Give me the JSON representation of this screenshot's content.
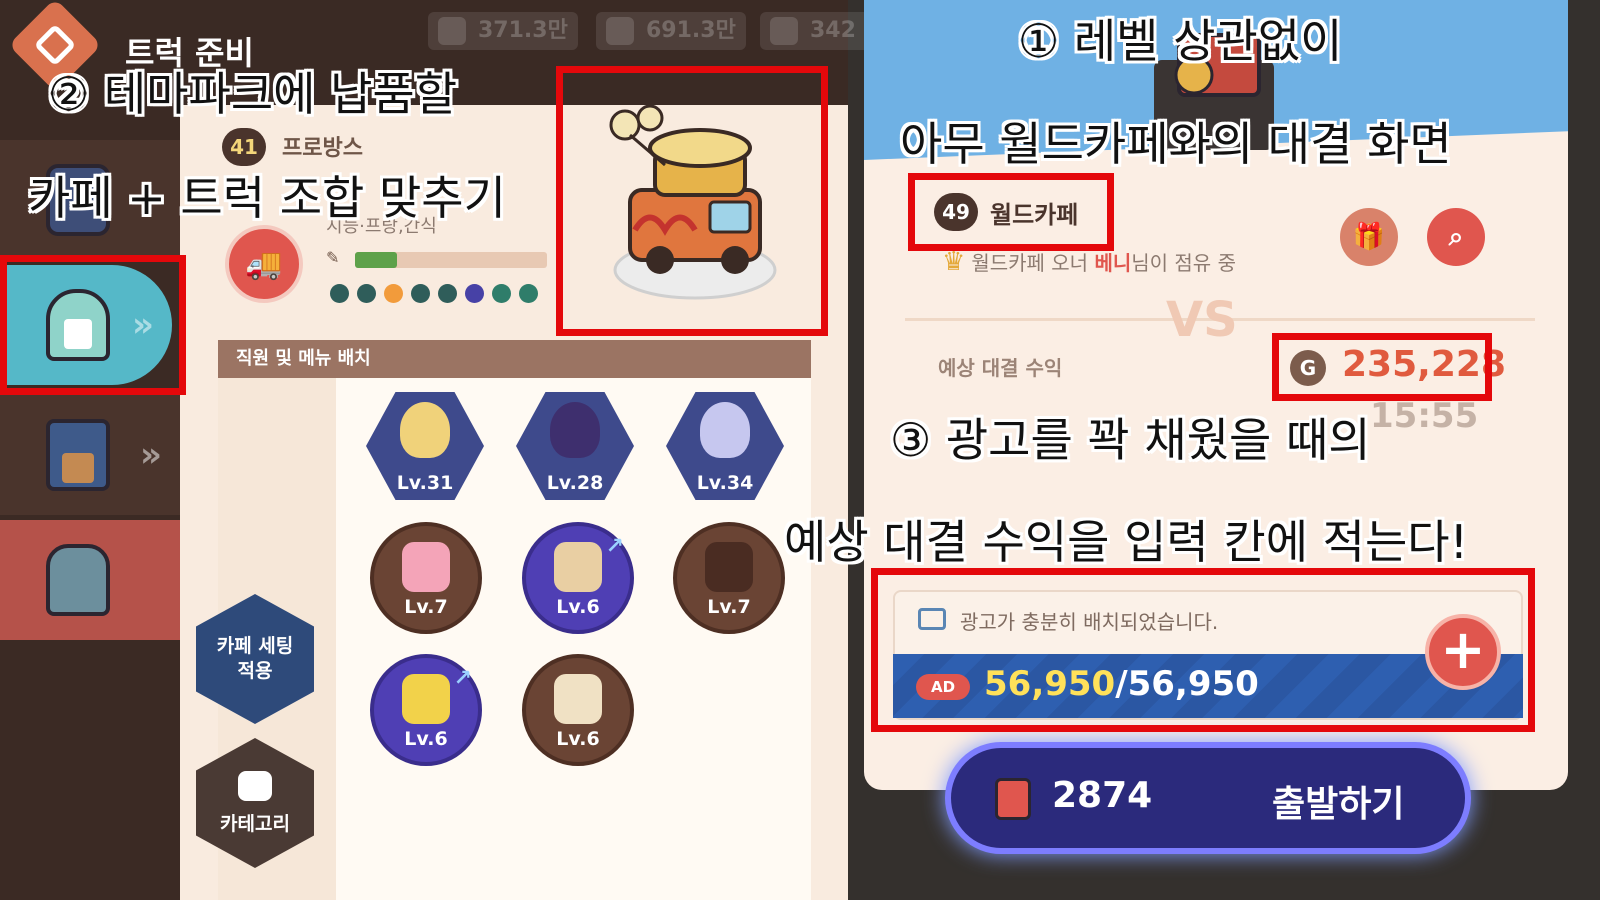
{
  "header": {
    "title": "트럭 준비"
  },
  "resources": [
    "371.3만",
    "691.3만",
    "342"
  ],
  "sidebar": {
    "items": [
      {
        "icon": "truck-icon",
        "state": "normal"
      },
      {
        "icon": "kiosk-icon",
        "state": "selected"
      },
      {
        "icon": "house-icon",
        "state": "normal"
      },
      {
        "icon": "gate-icon",
        "state": "normal"
      }
    ]
  },
  "cafe": {
    "level": "41",
    "name": "프로방스",
    "subtitle": "지능·프랑,간식",
    "progress": 0.22,
    "dots": [
      "#2f5d5a",
      "#2f5d5a",
      "#f29b3b",
      "#2f5d5a",
      "#2f5d5a",
      "#4741a6",
      "#2f7d6a",
      "#2f7d6a"
    ]
  },
  "staff_section": {
    "header": "직원 및 메뉴 배치"
  },
  "staff": [
    {
      "level": "Lv.31",
      "hair": "#f0d27a"
    },
    {
      "level": "Lv.28",
      "hair": "#3e2f6e"
    },
    {
      "level": "Lv.34",
      "hair": "#c6c7ef"
    }
  ],
  "menus": [
    {
      "level": "Lv.7",
      "style": "brown",
      "food": "#f4a4b8",
      "upgrade": false
    },
    {
      "level": "Lv.6",
      "style": "purple",
      "food": "#e9cfa3",
      "upgrade": true
    },
    {
      "level": "Lv.7",
      "style": "brown",
      "food": "#4a2c22",
      "upgrade": false
    },
    {
      "level": "Lv.6",
      "style": "purple",
      "food": "#f2d24a",
      "upgrade": true
    },
    {
      "level": "Lv.6",
      "style": "brown",
      "food": "#f0e1c4",
      "upgrade": false
    }
  ],
  "buttons": {
    "apply_setting": "카페 세팅 적용",
    "category": "카테고리"
  },
  "battle": {
    "level": "49",
    "name": "월드카페",
    "owner_prefix": "월드카페 오너",
    "owner_name": "베니",
    "owner_suffix": "님이 점유 중",
    "vs": "VS",
    "earn_label": "예상 대결 수익",
    "earn_value": "235,228",
    "timer": "15:55"
  },
  "ads": {
    "message": "광고가 충분히 배치되었습니다.",
    "tag": "AD",
    "current": "56,950",
    "max": "/56,950",
    "plus": "+"
  },
  "depart": {
    "fuel": "2874",
    "label": "출발하기"
  },
  "annotations": {
    "a1": "① 레벨 상관없이",
    "a1b": "아무 월드카페와의 대결 화면",
    "a2": "② 테마파크에 납품할",
    "a2b": "카페 + 트럭 조합 맞추기",
    "a3": "③ 광고를 꽉 채웠을 때의",
    "a3b": "예상 대결 수익을 입력 칸에 적는다!"
  },
  "colors": {
    "annotation_box": "#e4080b",
    "accent_red": "#e0564e",
    "coin": "#e05a3e"
  }
}
